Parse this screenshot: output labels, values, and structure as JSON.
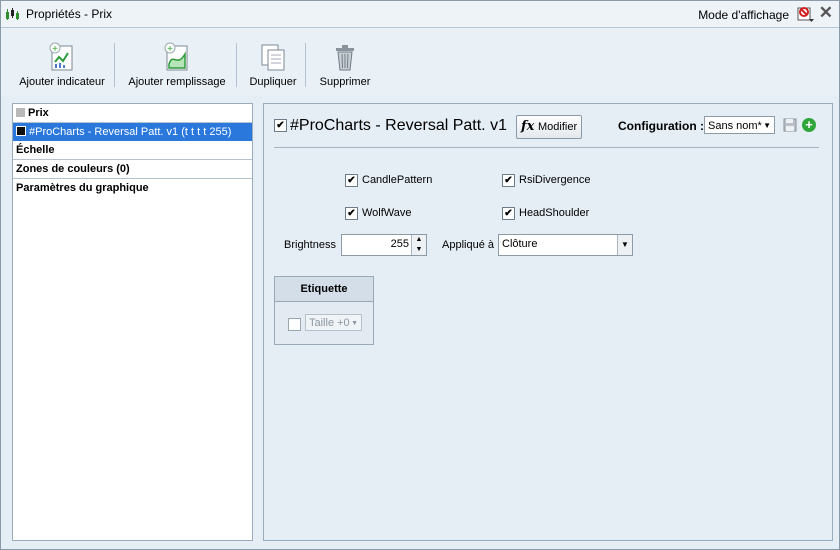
{
  "window": {
    "title": "Propriétés - Prix",
    "mode_label": "Mode d'affichage",
    "close_glyph": "✕"
  },
  "toolbar": {
    "items": [
      {
        "label": "Ajouter indicateur",
        "icon": "add-indicator-icon"
      },
      {
        "label": "Ajouter remplissage",
        "icon": "add-fill-icon"
      },
      {
        "label": "Dupliquer",
        "icon": "duplicate-icon"
      },
      {
        "label": "Supprimer",
        "icon": "trash-icon"
      }
    ]
  },
  "tree": {
    "items": [
      {
        "label": "Prix",
        "color": "#b9b9b9"
      },
      {
        "label": "#ProCharts - Reversal Patt. v1 (t t t t 255)",
        "color": "#101010"
      },
      {
        "label": "Échelle"
      },
      {
        "label": "Zones de couleurs (0)"
      },
      {
        "label": "Paramètres du graphique"
      }
    ]
  },
  "indicator": {
    "title": "#ProCharts - Reversal Patt. v1",
    "enabled": true,
    "modify_icon": "fx",
    "modify_label": "Modifier",
    "config_label": "Configuration :",
    "config_value": "Sans nom*"
  },
  "params": {
    "options": [
      {
        "label": "CandlePattern",
        "checked": true
      },
      {
        "label": "RsiDivergence",
        "checked": true
      },
      {
        "label": "WolfWave",
        "checked": true
      },
      {
        "label": "HeadShoulder",
        "checked": true
      }
    ],
    "brightness_label": "Brightness",
    "brightness_value": "255",
    "applique_label": "Appliqué à",
    "applique_value": "Clôture"
  },
  "etiquette": {
    "title": "Etiquette",
    "checked": false,
    "size_value": "Taille +0"
  },
  "colors": {
    "selection": "#2a78dc",
    "add_green": "#2fa53a"
  }
}
